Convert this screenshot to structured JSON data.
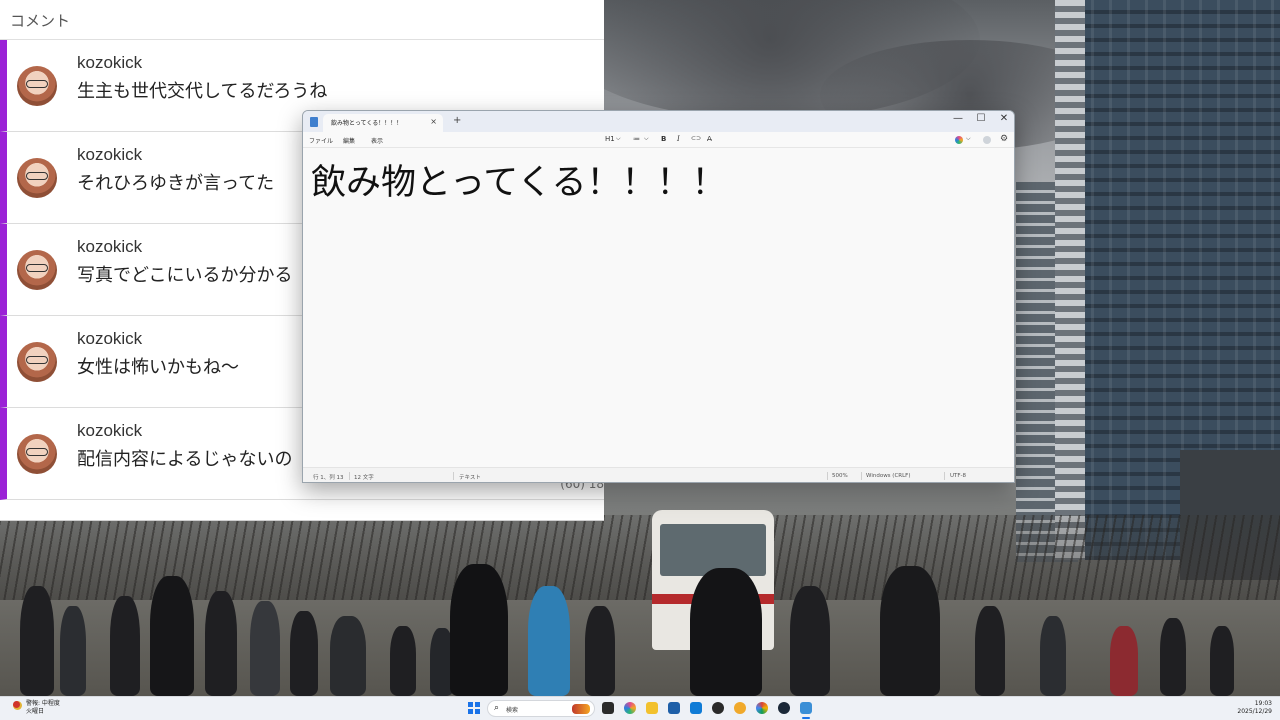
{
  "comments_panel": {
    "header": "コメント",
    "items": [
      {
        "user": "kozokick",
        "text": "生主も世代交代してるだろうね"
      },
      {
        "user": "kozokick",
        "text": "それひろゆきが言ってた"
      },
      {
        "user": "kozokick",
        "text": "写真でどこにいるか分かる"
      },
      {
        "user": "kozokick",
        "text": "女性は怖いかもね～"
      },
      {
        "user": "kozokick",
        "text": "配信内容によるじゃないの",
        "meta": "(60)  18"
      }
    ]
  },
  "notepad": {
    "tab_title": "飲み物とってくる！！！！",
    "tab_close": "×",
    "tab_add": "+",
    "window_controls": {
      "minimize": "—",
      "maximize": "☐",
      "close": "✕"
    },
    "menu": {
      "file": "ファイル",
      "edit": "編集",
      "view": "表示"
    },
    "format": {
      "heading": "H1",
      "heading_chevron": "⌵",
      "list": "≔",
      "list_chevron": "⌵",
      "bold": "B",
      "italic": "I",
      "link": "⊂⊃",
      "clear": "A̶"
    },
    "content": "飲み物とってくる！！！！",
    "status": {
      "position": "行 1、列 13",
      "chars": "12 文字",
      "format": "テキスト",
      "zoom": "500%",
      "line_ending": "Windows (CRLF)",
      "encoding": "UTF-8"
    }
  },
  "taskbar": {
    "weather_label": "警報: 中程度",
    "weather_day": "火曜日",
    "search_placeholder": "検索",
    "time": "19:03",
    "date": "2025/12/29"
  },
  "colors": {
    "comment_accent": "#9b22d6",
    "windows_blue": "#1a73e8"
  }
}
